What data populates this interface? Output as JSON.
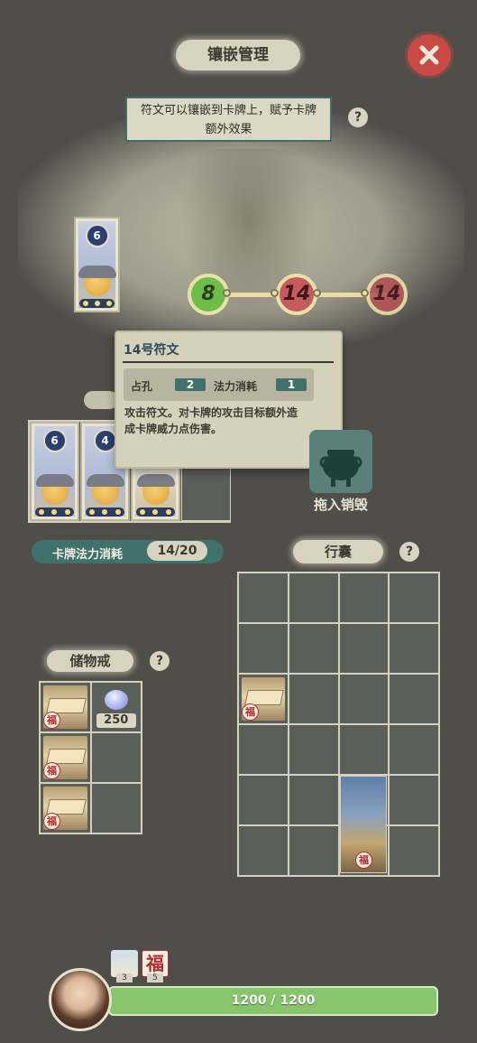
{
  "header": {
    "title": "镶嵌管理",
    "close_icon": "close-icon"
  },
  "info": {
    "text_line1": "符文可以镶嵌到卡牌上，赋予卡牌",
    "text_line2": "额外效果",
    "help": "?"
  },
  "selected_card": {
    "cost": "6"
  },
  "runes": [
    "8",
    "14",
    "14"
  ],
  "tooltip": {
    "title": "14号符文",
    "slots_label": "占孔",
    "slots_value": "2",
    "mana_label": "法力消耗",
    "mana_value": "1",
    "desc_line1": "攻击符文。对卡牌的攻击目标额外造",
    "desc_line2": "成卡牌威力点伤害。"
  },
  "deck_cards": [
    "6",
    "4",
    ""
  ],
  "destroy": {
    "label": "拖入销毁",
    "icon": "cauldron-icon"
  },
  "mana": {
    "label": "卡牌法力消耗",
    "value": "14/20"
  },
  "bag": {
    "title": "行囊",
    "help": "?"
  },
  "ring": {
    "title": "储物戒",
    "help": "?",
    "crystal_count": "250",
    "fu": "福"
  },
  "footer": {
    "hp": "1200 / 1200",
    "buff1_count": "3",
    "buff2_count": "5",
    "buff2_char": "福"
  },
  "colors": {
    "accent": "#3f726c",
    "hp": "#86c56b",
    "close": "#c94a44"
  }
}
